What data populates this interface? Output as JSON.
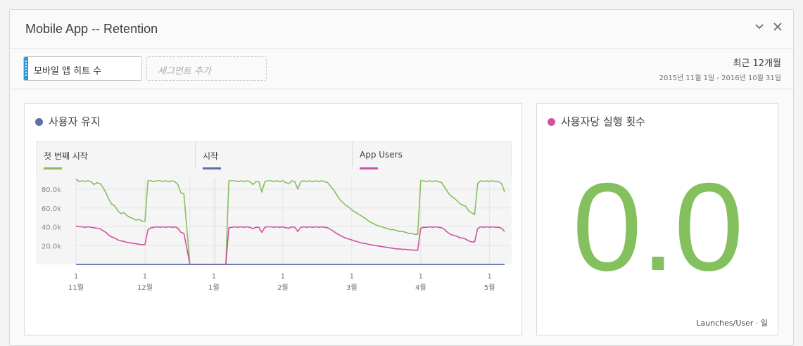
{
  "panel": {
    "title": "Mobile App -- Retention",
    "collapse_icon": "chevron-down-icon",
    "close_icon": "close-icon"
  },
  "segments": {
    "active": "모바일 앱 히트 수",
    "add_placeholder": "세그먼트 추가",
    "accent": "#2d9ad8"
  },
  "date_range": {
    "title": "최근 12개월",
    "range": "2015년 11월 1일 - 2016년 10월 31일"
  },
  "retention_card": {
    "title": "사용자 유지",
    "dot_color": "#5b6fad",
    "legend": [
      {
        "label": "첫 번째 시작",
        "color": "#84c05e"
      },
      {
        "label": "시작",
        "color": "#5b6fad"
      },
      {
        "label": "App Users",
        "color": "#d152a3"
      }
    ]
  },
  "chart_data": {
    "type": "line",
    "y_ticks": [
      "20.0k",
      "40.0k",
      "60.0k",
      "80.0k"
    ],
    "ylim": [
      0,
      92000
    ],
    "x_ticks": [
      {
        "day": "1",
        "month": "11월"
      },
      {
        "day": "1",
        "month": "12월"
      },
      {
        "day": "1",
        "month": "1월"
      },
      {
        "day": "1",
        "month": "2월"
      },
      {
        "day": "1",
        "month": "3월"
      },
      {
        "day": "1",
        "month": "4월"
      },
      {
        "day": "1",
        "month": "5월"
      }
    ],
    "grid": true,
    "series": [
      {
        "name": "첫 번째 시작",
        "color": "#84c05e",
        "values": [
          91000,
          88000,
          89000,
          88000,
          89000,
          88000,
          85000,
          87000,
          86000,
          82000,
          76000,
          69000,
          64000,
          62000,
          57000,
          54000,
          55000,
          52000,
          50000,
          49000,
          47000,
          48000,
          46000,
          46000,
          89000,
          89000,
          88000,
          89000,
          89000,
          88000,
          89000,
          88000,
          89000,
          88000,
          85000,
          76000,
          75000,
          37000,
          0,
          0,
          0,
          0,
          0,
          0,
          0,
          0,
          0,
          0,
          0,
          0,
          0,
          89000,
          89000,
          89000,
          88000,
          89000,
          88000,
          89000,
          88000,
          85000,
          88000,
          88000,
          77000,
          88000,
          89000,
          89000,
          88000,
          89000,
          88000,
          89000,
          87000,
          86000,
          89000,
          88000,
          80000,
          88000,
          89000,
          88000,
          89000,
          88000,
          89000,
          88000,
          89000,
          88000,
          87000,
          83000,
          79000,
          74000,
          69000,
          66000,
          63000,
          61000,
          58000,
          56000,
          54000,
          52000,
          50000,
          48000,
          45000,
          44000,
          42000,
          41000,
          40000,
          39000,
          38000,
          37000,
          37000,
          36000,
          35000,
          35000,
          34000,
          33000,
          33000,
          32000,
          32000,
          89000,
          89000,
          88000,
          89000,
          88000,
          89000,
          88000,
          87000,
          82000,
          77000,
          73000,
          71000,
          68000,
          65000,
          63000,
          62000,
          57000,
          55000,
          53000,
          86000,
          89000,
          88000,
          89000,
          88000,
          89000,
          88000,
          88000,
          86000,
          77000
        ]
      },
      {
        "name": "시작",
        "color": "#5b6fad",
        "values": [
          0,
          0
        ]
      },
      {
        "name": "App Users",
        "color": "#d152a3",
        "values": [
          41000,
          40000,
          40000,
          39500,
          40000,
          39500,
          39000,
          38500,
          38000,
          36000,
          34000,
          31000,
          29000,
          28000,
          26000,
          25000,
          24500,
          23500,
          23000,
          22500,
          22000,
          21500,
          21000,
          21000,
          37000,
          39000,
          39500,
          40000,
          39500,
          40000,
          39500,
          40000,
          39500,
          40000,
          38500,
          34000,
          33000,
          17000,
          0,
          0,
          0,
          0,
          0,
          0,
          0,
          0,
          0,
          0,
          0,
          0,
          0,
          39000,
          39500,
          40000,
          39500,
          40000,
          39500,
          40000,
          39500,
          38000,
          39500,
          39500,
          34000,
          39500,
          40000,
          40000,
          39500,
          40000,
          39500,
          40000,
          39000,
          38500,
          40000,
          39500,
          35000,
          39500,
          40000,
          39500,
          40000,
          39500,
          40000,
          39500,
          40000,
          39500,
          39000,
          37000,
          35000,
          33000,
          31000,
          29500,
          28000,
          27000,
          26000,
          25000,
          24000,
          23000,
          22500,
          22000,
          21000,
          20500,
          20000,
          19500,
          19000,
          18500,
          18000,
          17500,
          17000,
          16500,
          16500,
          16000,
          16000,
          15500,
          15500,
          15000,
          15000,
          38500,
          39500,
          39500,
          40000,
          39500,
          40000,
          39500,
          39000,
          37000,
          34000,
          32000,
          31000,
          30000,
          28500,
          28000,
          27000,
          25000,
          24000,
          24000,
          38000,
          40000,
          39500,
          40000,
          39500,
          40000,
          39500,
          39500,
          38500,
          35000
        ]
      }
    ]
  },
  "kpi_card": {
    "title": "사용자당 실행 횟수",
    "dot_color": "#d152a3",
    "value": "0.0",
    "value_color": "#84c05e",
    "footer": "Launches/User · 일"
  }
}
